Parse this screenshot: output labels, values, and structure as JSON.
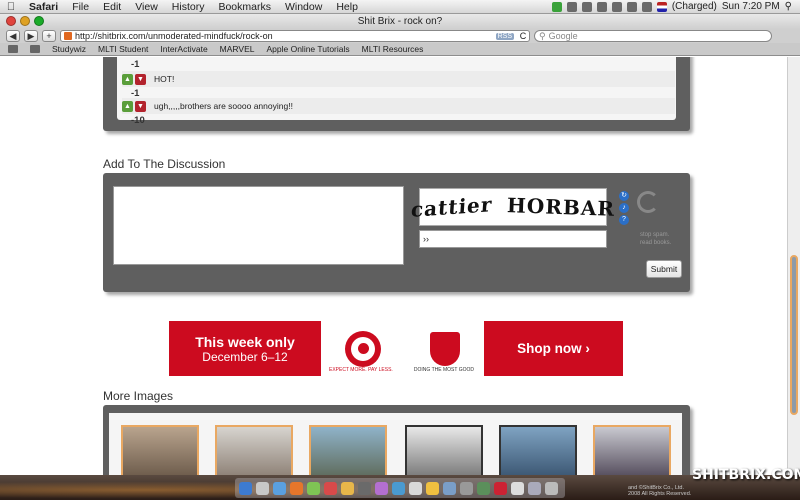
{
  "menubar": {
    "apple": "",
    "app_name": "Safari",
    "menus": [
      "File",
      "Edit",
      "View",
      "History",
      "Bookmarks",
      "Window",
      "Help"
    ],
    "battery": "(Charged)",
    "clock": "Sun 7:20 PM"
  },
  "window": {
    "title": "Shit Brix - rock on?"
  },
  "toolbar": {
    "back": "◀",
    "forward": "▶",
    "add": "+",
    "url": "http://shitbrix.com/unmoderated-mindfuck/rock-on",
    "rss": "RSS",
    "reload": "C",
    "search_placeholder": "Google"
  },
  "bookmarks": [
    "Studywiz",
    "MLTI Student",
    "InterActivate",
    "MARVEL",
    "Apple Online Tutorials",
    "MLTI Resources"
  ],
  "comments": [
    {
      "score": "-1",
      "text": "HOT!"
    },
    {
      "score": "-1",
      "text": "ugh,,,,,brothers are soooo annoying!!"
    },
    {
      "score": "-10"
    }
  ],
  "discussion": {
    "title": "Add To The Discussion",
    "captcha_word1": "cattier",
    "captcha_word2": "HORBAR",
    "captcha_input": "››",
    "captcha_tagline": [
      "stop spam.",
      "read books."
    ],
    "submit": "Submit"
  },
  "ad": {
    "headline": "This week only",
    "dates": "December 6–12",
    "target_tag": "EXPECT MORE. PAY LESS.",
    "salvation_tag": "DOING THE MOST GOOD",
    "cta": "Shop now ›"
  },
  "more_images": {
    "title": "More Images"
  },
  "wallpaper": {
    "brand": "SHITBRIX.COM",
    "credit": [
      "and ©ShitBrix Co., Ltd.",
      "2008 All Rights Reserved."
    ]
  },
  "colors": {
    "panel": "#5f5f5f",
    "target_red": "#cc0b1f",
    "vote_up": "#5a9e3a",
    "vote_down": "#b3232d"
  }
}
